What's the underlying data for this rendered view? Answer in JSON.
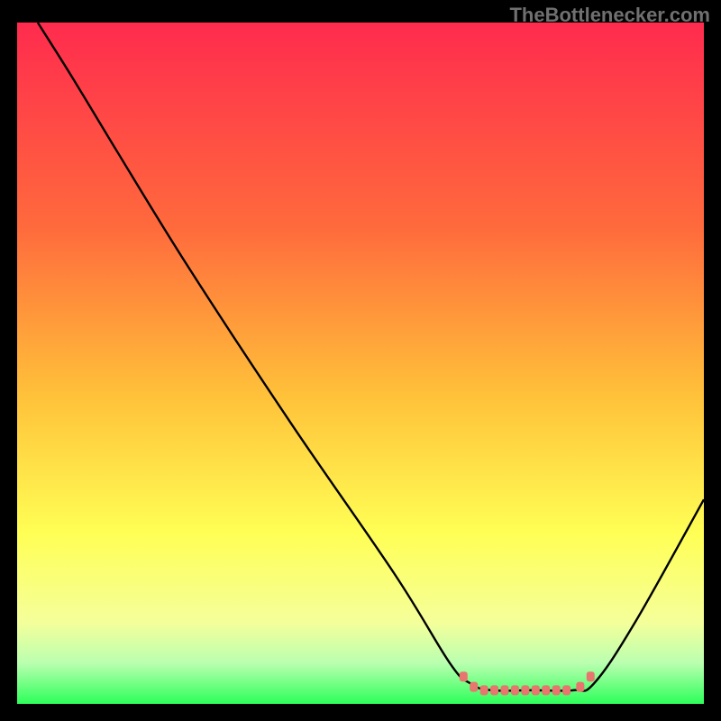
{
  "watermark": "TheBottlenecker.com",
  "chart_data": {
    "type": "line",
    "title": "",
    "xlabel": "",
    "ylabel": "",
    "xlim": [
      0,
      100
    ],
    "ylim": [
      0,
      100
    ],
    "gradient_stops": [
      {
        "offset": 0,
        "color": "#ff2b4e"
      },
      {
        "offset": 30,
        "color": "#ff6a3c"
      },
      {
        "offset": 55,
        "color": "#ffc23a"
      },
      {
        "offset": 75,
        "color": "#ffff55"
      },
      {
        "offset": 88,
        "color": "#f5ff9a"
      },
      {
        "offset": 94,
        "color": "#baffb0"
      },
      {
        "offset": 100,
        "color": "#2dff5a"
      }
    ],
    "series": [
      {
        "name": "bottleneck-curve",
        "stroke": "#000000",
        "points": [
          {
            "x": 3,
            "y": 100
          },
          {
            "x": 8,
            "y": 92
          },
          {
            "x": 14,
            "y": 82
          },
          {
            "x": 25,
            "y": 64
          },
          {
            "x": 40,
            "y": 41
          },
          {
            "x": 55,
            "y": 19
          },
          {
            "x": 63,
            "y": 6
          },
          {
            "x": 66,
            "y": 3
          },
          {
            "x": 69,
            "y": 2
          },
          {
            "x": 75,
            "y": 2
          },
          {
            "x": 81,
            "y": 2
          },
          {
            "x": 84,
            "y": 3
          },
          {
            "x": 90,
            "y": 12
          },
          {
            "x": 100,
            "y": 30
          }
        ]
      },
      {
        "name": "highlight-dots",
        "stroke": "#e8766f",
        "points": [
          {
            "x": 65,
            "y": 4
          },
          {
            "x": 66.5,
            "y": 2.5
          },
          {
            "x": 68,
            "y": 2
          },
          {
            "x": 69.5,
            "y": 2
          },
          {
            "x": 71,
            "y": 2
          },
          {
            "x": 72.5,
            "y": 2
          },
          {
            "x": 74,
            "y": 2
          },
          {
            "x": 75.5,
            "y": 2
          },
          {
            "x": 77,
            "y": 2
          },
          {
            "x": 78.5,
            "y": 2
          },
          {
            "x": 80,
            "y": 2
          },
          {
            "x": 82,
            "y": 2.5
          },
          {
            "x": 83.5,
            "y": 4
          }
        ]
      }
    ]
  }
}
